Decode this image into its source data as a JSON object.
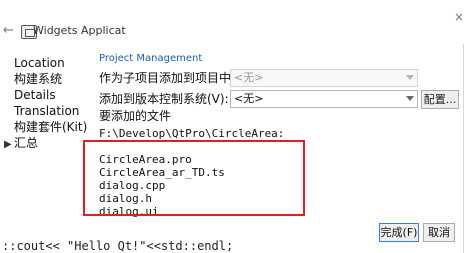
{
  "window": {
    "title": "Widgets Applicat",
    "back_icon": "arrow-left-icon",
    "app_icon": "window-icon",
    "close_label": "×"
  },
  "steps": [
    {
      "label": "Location"
    },
    {
      "label": "构建系统"
    },
    {
      "label": "Details"
    },
    {
      "label": "Translation"
    },
    {
      "label": "构建套件(Kit)"
    },
    {
      "label": "汇总",
      "current": true,
      "marker": "▶"
    }
  ],
  "page": {
    "section_title": "Project Management",
    "subproject_label": "作为子项目添加到项目中:",
    "subproject_value": "<无>",
    "vcs_label": "添加到版本控制系统(V):",
    "vcs_value": "<无>",
    "config_button": "配置...",
    "files_heading": "要添加的文件",
    "files_path": "F:\\Develop\\QtPro\\CircleArea:",
    "files": [
      "CircleArea.pro",
      "CircleArea_ar_TD.ts",
      "dialog.cpp",
      "dialog.h",
      "dialog.ui"
    ]
  },
  "footer": {
    "background_code": "::cout<< \"Hello Qt!\"<<std::endl;",
    "finish_button": "完成(F)",
    "cancel_button": "取消"
  }
}
